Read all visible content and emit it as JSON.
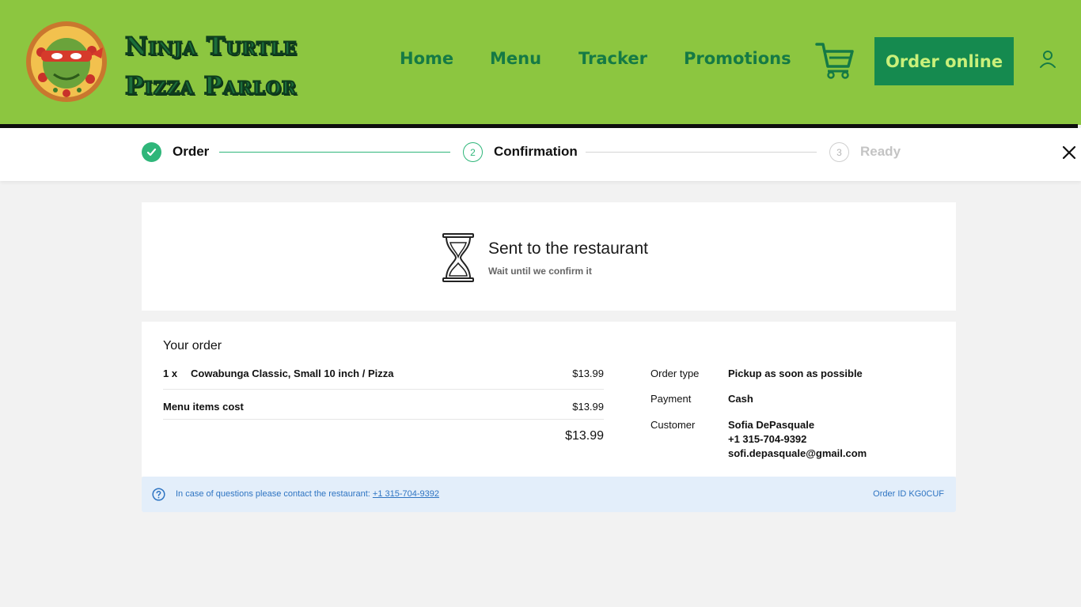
{
  "brand": {
    "line1": "Ninja Turtle",
    "line2": "Pizza Parlor"
  },
  "nav": {
    "home": "Home",
    "menu": "Menu",
    "tracker": "Tracker",
    "promotions": "Promotions"
  },
  "header": {
    "order_button": "Order online"
  },
  "steps": [
    {
      "number": "1",
      "label": "Order",
      "state": "done"
    },
    {
      "number": "2",
      "label": "Confirmation",
      "state": "active"
    },
    {
      "number": "3",
      "label": "Ready",
      "state": "pending"
    }
  ],
  "status": {
    "title": "Sent to the restaurant",
    "subtitle": "Wait until we confirm it"
  },
  "order": {
    "heading": "Your order",
    "items": [
      {
        "qty": "1 x",
        "name": "Cowabunga Classic, Small 10 inch / Pizza",
        "price": "$13.99"
      }
    ],
    "menu_cost_label": "Menu items cost",
    "menu_cost_value": "$13.99",
    "total": "$13.99"
  },
  "details": {
    "order_type_label": "Order type",
    "order_type_value": "Pickup as soon as possible",
    "payment_label": "Payment",
    "payment_value": "Cash",
    "customer_label": "Customer",
    "customer_name": "Sofia DePasquale",
    "customer_phone": "+1 315-704-9392",
    "customer_email": "sofi.depasquale@gmail.com"
  },
  "footer": {
    "contact_text": "In case of questions please contact the restaurant:",
    "contact_phone": "+1 315-704-9392",
    "order_id": "Order ID KG0CUF"
  },
  "colors": {
    "header_bg": "#8cc640",
    "brand_green": "#158a4f",
    "step_active": "#2fb67a",
    "info_blue": "#2e74c2"
  }
}
